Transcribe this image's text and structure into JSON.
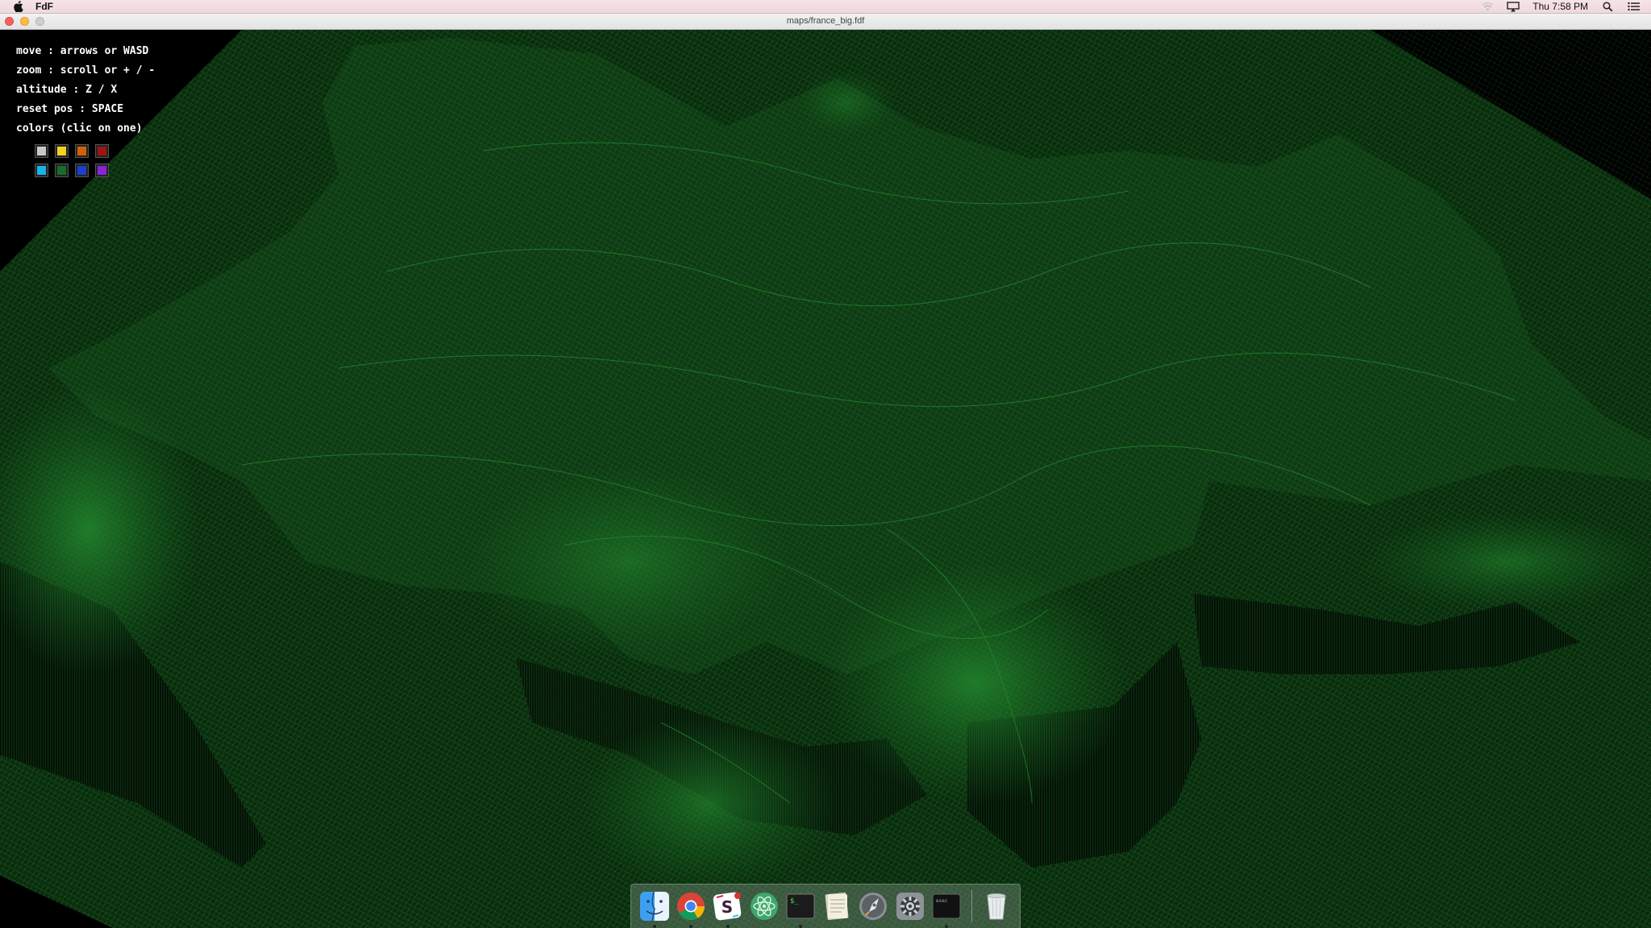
{
  "menubar": {
    "app_name": "FdF",
    "clock": "Thu 7:58 PM",
    "icons": [
      "apple-icon",
      "wifi-icon",
      "airplay-icon",
      "spotlight-icon",
      "notification-center-icon"
    ]
  },
  "window": {
    "title": "maps/france_big.fdf"
  },
  "help": {
    "move": "move : arrows or WASD",
    "zoom": "zoom : scroll or + / -",
    "altitude": "altitude : Z / X",
    "reset": "reset pos : SPACE",
    "colors": "colors (clic on one)"
  },
  "palette": {
    "row1": [
      "#c8c8c8",
      "#f2d21c",
      "#d35f0a",
      "#a01414"
    ],
    "row2": [
      "#1ab2ec",
      "#1a6b2c",
      "#1a3fd0",
      "#8b24d8"
    ]
  },
  "terrain_color": "#1b6b24",
  "dock": {
    "items": [
      "finder-icon",
      "chrome-icon",
      "slack-icon",
      "atom-icon",
      "terminal-icon",
      "notes-icon",
      "launchpad-icon",
      "system-preferences-icon",
      "terminal-2-icon",
      "trash-icon"
    ]
  }
}
